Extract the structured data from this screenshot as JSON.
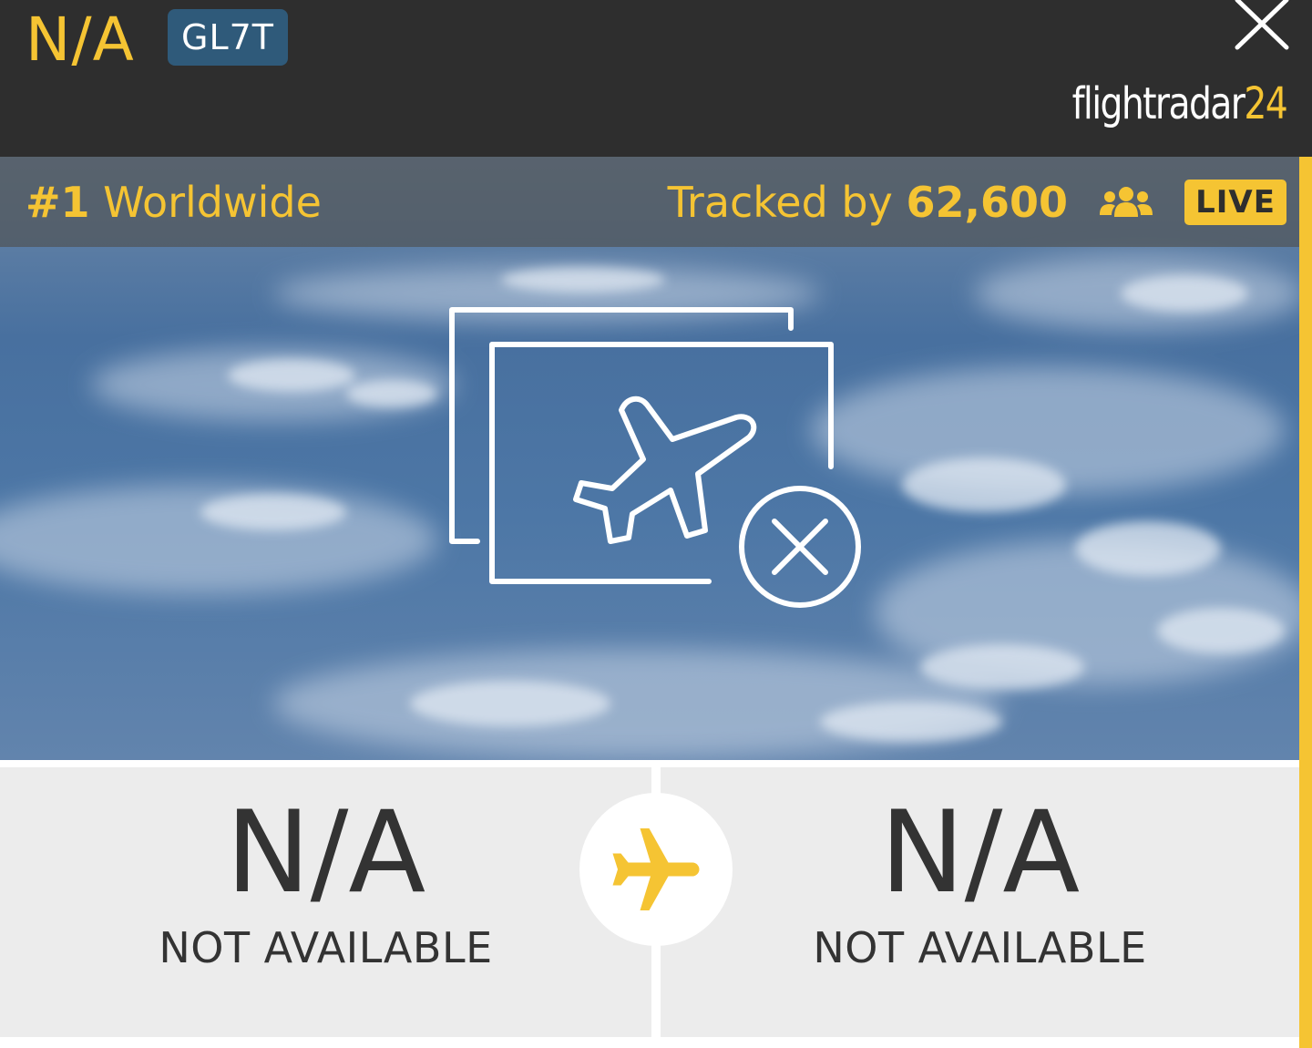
{
  "header": {
    "flight_number": "N/A",
    "callsign": "GL7T",
    "brand_text": "flightradar",
    "brand_number": "24",
    "close_icon": "close-icon"
  },
  "hero": {
    "rank_strong": "#1",
    "rank_text": " Worldwide",
    "tracked_prefix": "Tracked by ",
    "tracked_count": "62,600",
    "users_icon": "users-icon",
    "live_label": "LIVE",
    "placeholder_icon": "no-photo-plane-icon"
  },
  "route": {
    "origin": {
      "code": "N/A",
      "name": "NOT AVAILABLE"
    },
    "destination": {
      "code": "N/A",
      "name": "NOT AVAILABLE"
    },
    "plane_icon": "plane-icon"
  },
  "colors": {
    "accent": "#f5c433",
    "header_bg": "#2e2e2e",
    "badge_bg": "#2f5a7a",
    "panel_bg": "#ececec",
    "text_dark": "#333333"
  }
}
